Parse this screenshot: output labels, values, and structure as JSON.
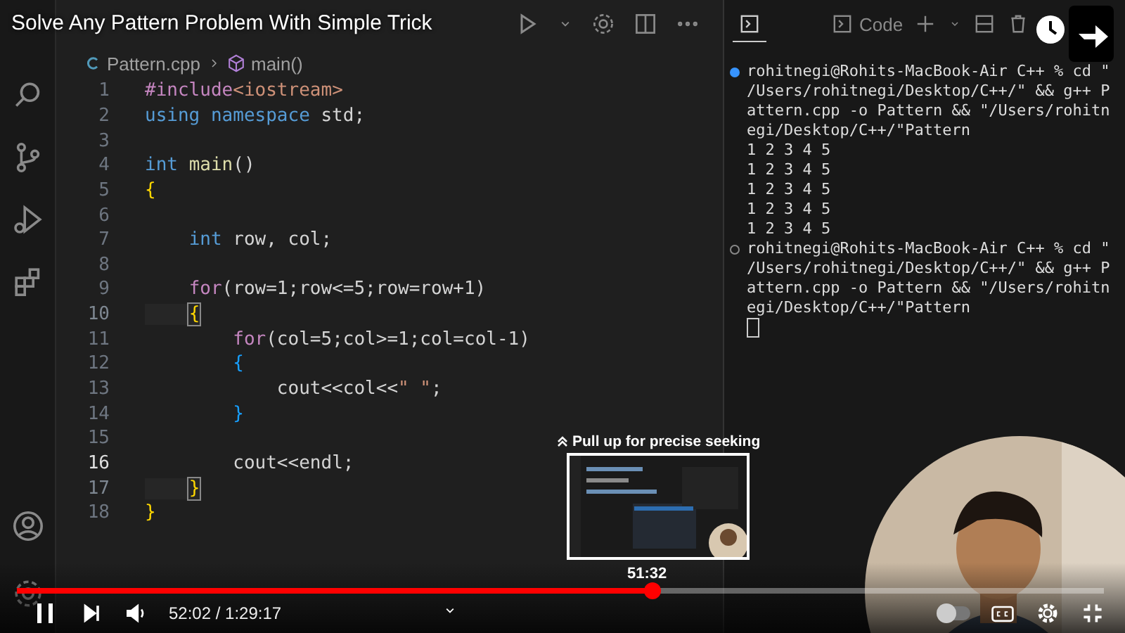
{
  "video_title": "Solve Any Pattern Problem With Simple Trick",
  "editor": {
    "breadcrumb": {
      "file": "Pattern.cpp",
      "symbol": "main()"
    },
    "lines": [
      {
        "number": "1",
        "current": false,
        "matched": false,
        "tokens": [
          {
            "text": "#include",
            "kind": "directive"
          },
          {
            "text": "<iostream>",
            "kind": "string"
          }
        ]
      },
      {
        "number": "2",
        "current": false,
        "matched": false,
        "tokens": [
          {
            "text": "using namespace",
            "kind": "keyword"
          },
          {
            "text": " std;",
            "kind": "plain"
          }
        ]
      },
      {
        "number": "3",
        "current": false,
        "matched": false
      },
      {
        "number": "4",
        "current": false,
        "matched": false,
        "tokens": [
          {
            "text": "int",
            "kind": "keyword"
          },
          {
            "text": " main",
            "kind": "function"
          },
          {
            "text": "()",
            "kind": "plain"
          }
        ]
      },
      {
        "number": "5",
        "current": false,
        "matched": false,
        "tokens": [
          {
            "text": "{",
            "kind": "brace"
          }
        ]
      },
      {
        "number": "6",
        "current": false,
        "matched": false
      },
      {
        "number": "7",
        "current": false,
        "matched": false,
        "tokens": [
          {
            "text": "    int",
            "kind": "keyword"
          },
          {
            "text": " row, col;",
            "kind": "plain"
          }
        ]
      },
      {
        "number": "8",
        "current": false,
        "matched": false
      },
      {
        "number": "9",
        "current": false,
        "matched": false,
        "tokens": [
          {
            "text": "    for",
            "kind": "directive"
          },
          {
            "text": "(row=1;row<=5;row=row+1)",
            "kind": "plain"
          }
        ]
      },
      {
        "number": "10",
        "current": false,
        "matched": true,
        "tokens": [
          {
            "text": "    {",
            "kind": "brace"
          }
        ]
      },
      {
        "number": "11",
        "current": false,
        "matched": false,
        "tokens": [
          {
            "text": "        for",
            "kind": "directive"
          },
          {
            "text": "(col=5;col>=1;col=col-1)",
            "kind": "plain"
          }
        ]
      },
      {
        "number": "12",
        "current": false,
        "matched": false,
        "tokens": [
          {
            "text": "        {",
            "kind": "brace2"
          }
        ]
      },
      {
        "number": "13",
        "current": false,
        "matched": false,
        "tokens": [
          {
            "text": "            cout<<col<<",
            "kind": "plain"
          },
          {
            "text": "\" \"",
            "kind": "string"
          },
          {
            "text": ";",
            "kind": "plain"
          }
        ]
      },
      {
        "number": "14",
        "current": false,
        "matched": false,
        "tokens": [
          {
            "text": "        }",
            "kind": "brace2"
          }
        ]
      },
      {
        "number": "15",
        "current": false,
        "matched": false
      },
      {
        "number": "16",
        "current": true,
        "matched": false,
        "tokens": [
          {
            "text": "        cout<<endl;",
            "kind": "plain"
          }
        ]
      },
      {
        "number": "17",
        "current": false,
        "matched": true,
        "tokens": [
          {
            "text": "    }",
            "kind": "brace"
          }
        ]
      },
      {
        "number": "18",
        "current": false,
        "matched": false,
        "tokens": [
          {
            "text": "}",
            "kind": "brace"
          }
        ]
      }
    ]
  },
  "terminal": {
    "profile": "Code",
    "lines": [
      {
        "kind": "prompt",
        "finished": true,
        "text": "rohitnegi@Rohits-MacBook-Air C++ % cd \""
      },
      {
        "kind": "output",
        "text": "/Users/rohitnegi/Desktop/C++/\" && g++ P"
      },
      {
        "kind": "output",
        "text": "attern.cpp -o Pattern && \"/Users/rohitn"
      },
      {
        "kind": "output",
        "text": "egi/Desktop/C++/\"Pattern"
      },
      {
        "kind": "output",
        "text": "1 2 3 4 5"
      },
      {
        "kind": "output",
        "text": "1 2 3 4 5"
      },
      {
        "kind": "output",
        "text": "1 2 3 4 5"
      },
      {
        "kind": "output",
        "text": "1 2 3 4 5"
      },
      {
        "kind": "output",
        "text": "1 2 3 4 5"
      },
      {
        "kind": "prompt",
        "finished": false,
        "text": "rohitnegi@Rohits-MacBook-Air C++ % cd \""
      },
      {
        "kind": "output",
        "text": "/Users/rohitnegi/Desktop/C++/\" && g++ P"
      },
      {
        "kind": "output",
        "text": "attern.cpp -o Pattern && \"/Users/rohitn"
      },
      {
        "kind": "output",
        "text": "egi/Desktop/C++/\"Pattern"
      },
      {
        "kind": "cursor"
      }
    ]
  },
  "seek_preview": {
    "hint": "Pull up for precise seeking",
    "time": "51:32"
  },
  "player": {
    "level": 0.585,
    "time": "52:02 / 1:29:17",
    "autoplay": {
      "on": false
    }
  }
}
